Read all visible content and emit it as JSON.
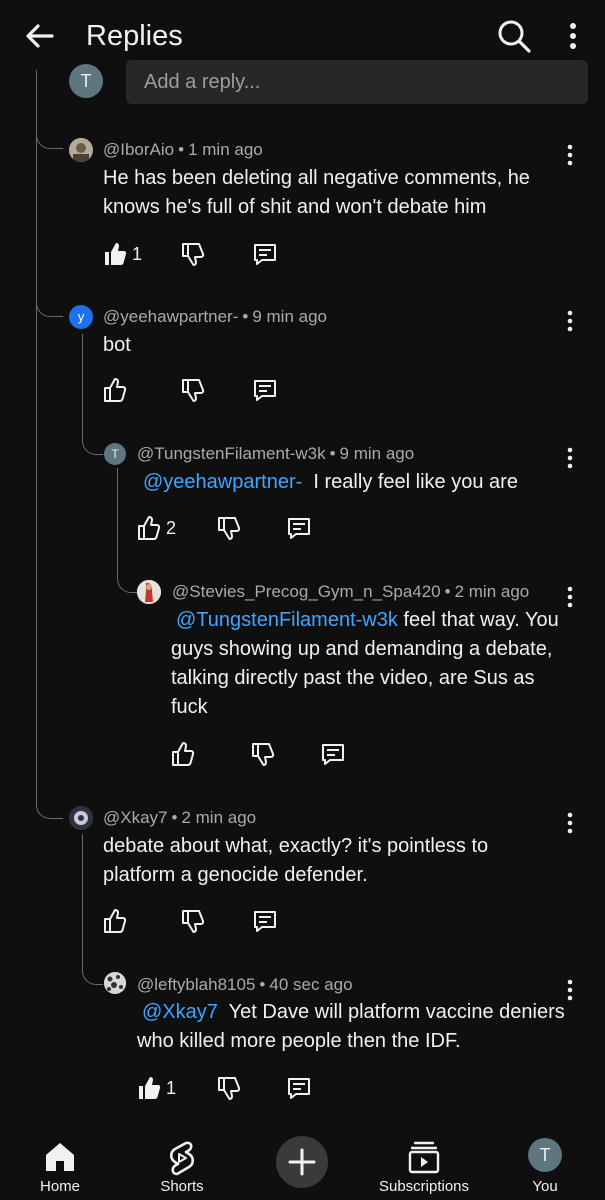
{
  "header": {
    "title": "Replies"
  },
  "reply_box": {
    "avatar_letter": "T",
    "placeholder": "Add a reply..."
  },
  "comments": [
    {
      "handle": "@IborAio",
      "time": "1 min ago",
      "text": "He has been deleting all negative comments, he knows he's full of shit and won't debate him",
      "likes": "1",
      "liked": true
    },
    {
      "handle": "@yeehawpartner-",
      "time": "9 min ago",
      "avatar_letter": "y",
      "text": "bot",
      "likes": ""
    },
    {
      "handle": "@TungstenFilament-w3k",
      "time": "9 min ago",
      "avatar_letter": "T",
      "mention": "@yeehawpartner-",
      "text": "I really feel like you are",
      "likes": "2"
    },
    {
      "handle": "@Stevies_Precog_Gym_n_Spa420",
      "time": "2 min ago",
      "mention": "@TungstenFilament-w3k",
      "text_line1": "feel that way. You",
      "text_rest": "guys showing up and demanding a debate, talking directly past the video, are Sus as fuck",
      "likes": ""
    },
    {
      "handle": "@Xkay7",
      "time": "2 min ago",
      "text": "debate about what, exactly? it's pointless to platform a genocide defender.",
      "likes": ""
    },
    {
      "handle": "@leftyblah8105",
      "time": "40 sec ago",
      "mention": "@Xkay7",
      "text": "Yet Dave will platform vaccine deniers who killed more people then the IDF.",
      "likes": "1",
      "liked": true
    }
  ],
  "bottom_nav": {
    "home": "Home",
    "shorts": "Shorts",
    "subscriptions": "Subscriptions",
    "you": "You",
    "you_avatar_letter": "T"
  },
  "colors": {
    "background": "#0f0f0f",
    "mention": "#3ea6ff",
    "input_bg": "#272727",
    "thread_line": "#6b6b6b"
  }
}
